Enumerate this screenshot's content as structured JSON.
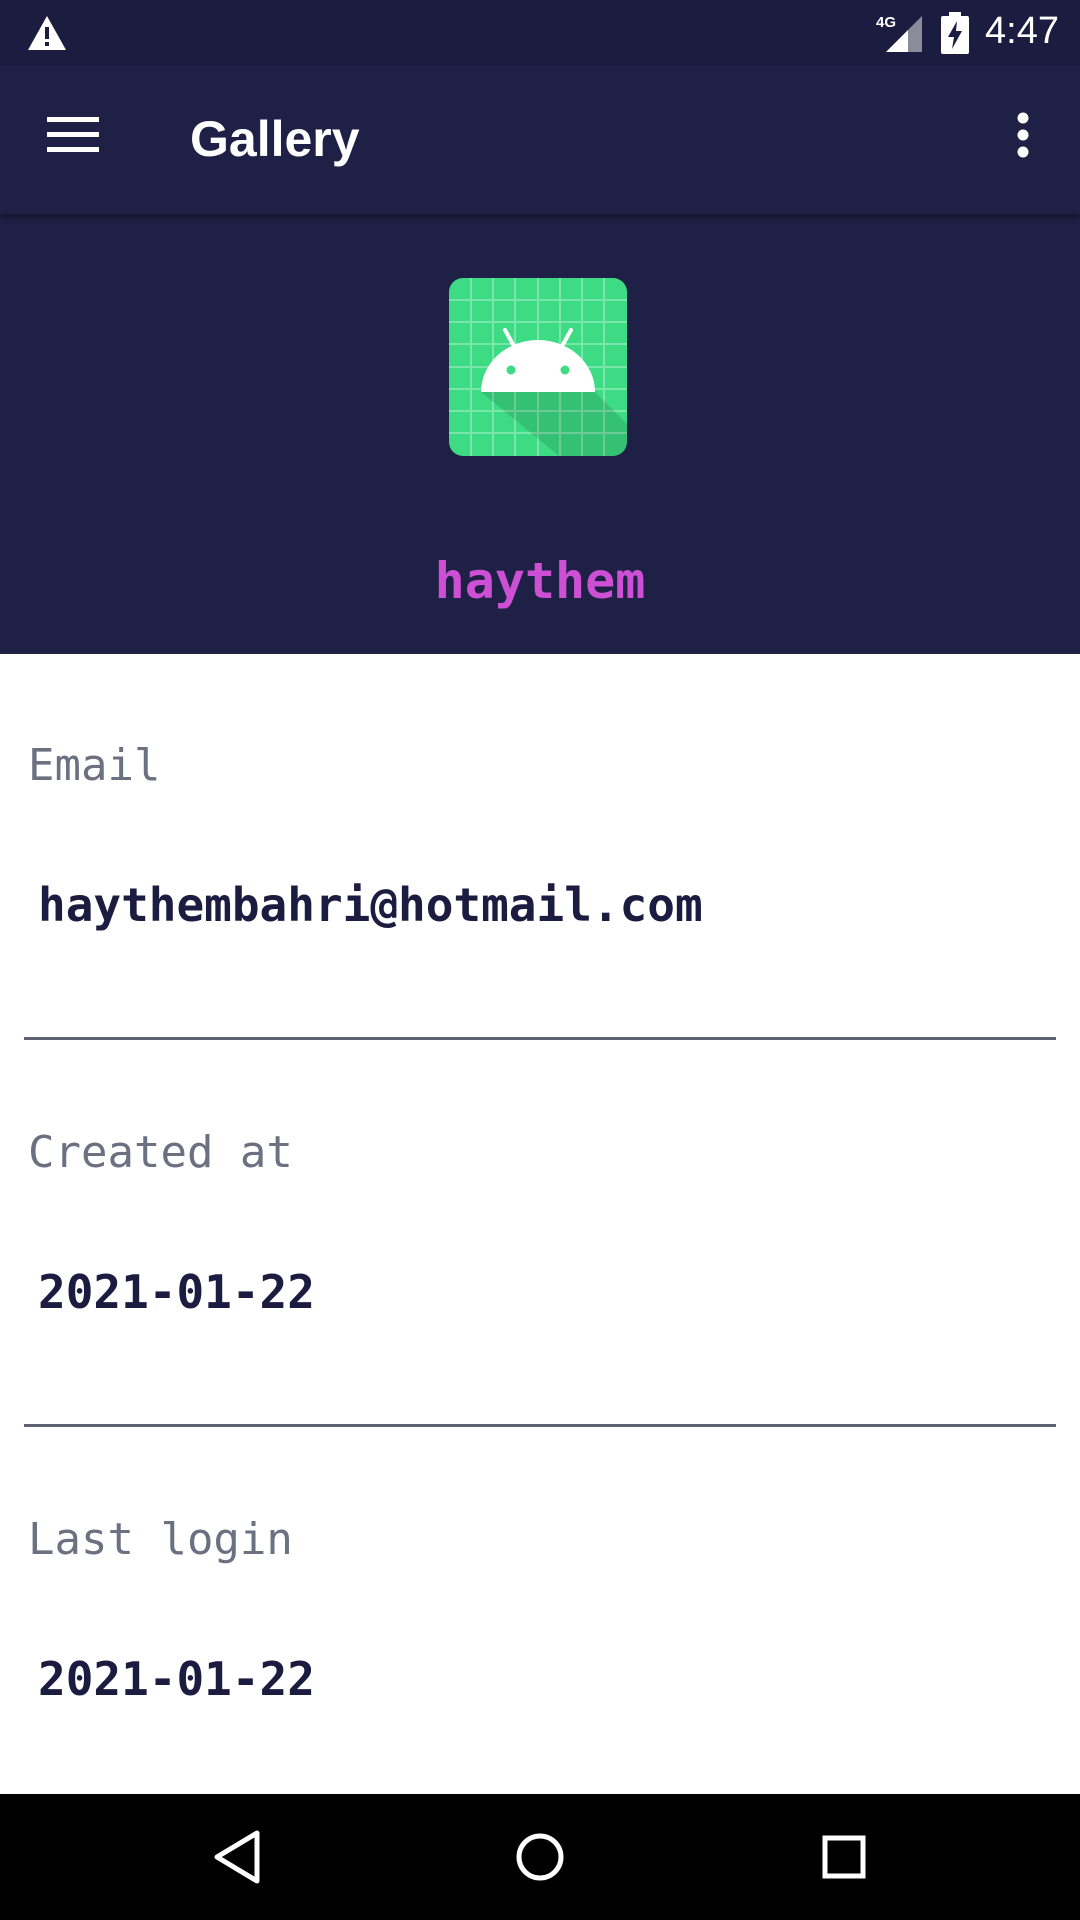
{
  "status_bar": {
    "network_type": "4G",
    "time": "4:47"
  },
  "app_bar": {
    "title": "Gallery"
  },
  "profile": {
    "username": "haythem"
  },
  "fields": {
    "email_label": "Email",
    "email_value": "haythembahri@hotmail.com",
    "created_label": "Created at",
    "created_value": "2021-01-22",
    "last_login_label": "Last login",
    "last_login_value": "2021-01-22"
  },
  "icons": {
    "warning": "warning-icon",
    "signal": "signal-icon",
    "battery": "battery-charging-icon",
    "menu": "hamburger-menu-icon",
    "overflow": "more-vert-icon",
    "avatar": "android-robot-icon",
    "back": "back-triangle-icon",
    "home": "home-circle-icon",
    "recents": "recents-square-icon"
  },
  "colors": {
    "status_bar": "#1b1c40",
    "app_bar": "#1f2045",
    "username": "#cc4fd4",
    "value_text": "#1b1c40",
    "label_text": "#6b7180",
    "avatar_green": "#3ddc84"
  }
}
